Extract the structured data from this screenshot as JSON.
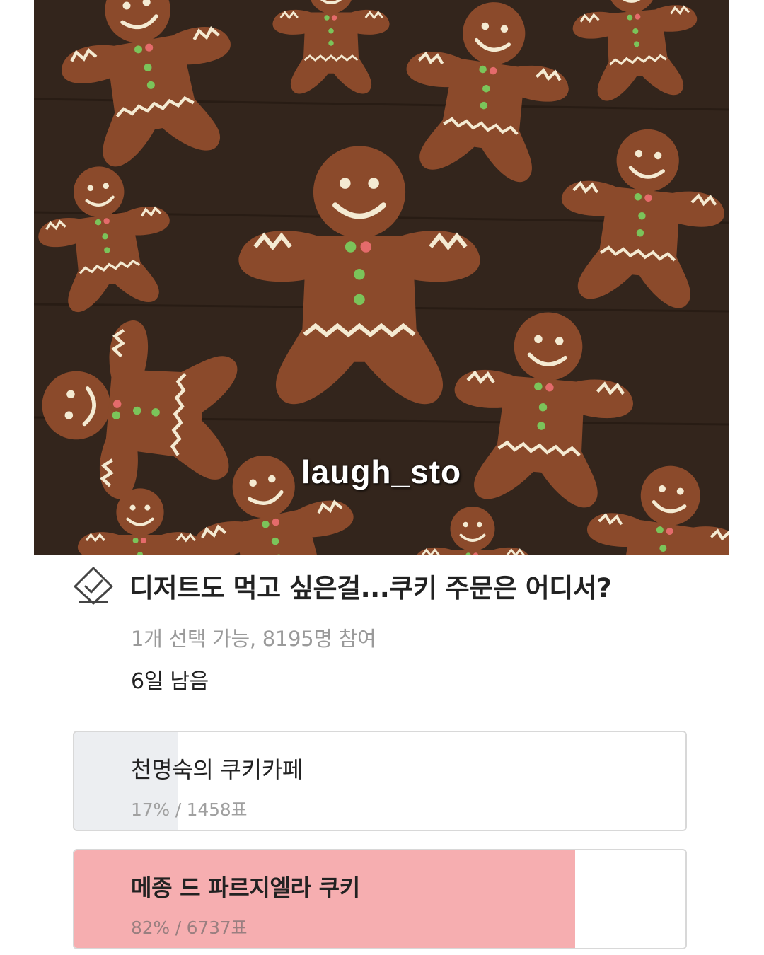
{
  "watermark": "laugh_sto",
  "poll": {
    "title": "디저트도 먹고 싶은걸...쿠키 주문은 어디서?",
    "meta": "1개 선택 가능, 8195명 참여",
    "remaining": "6일 남음",
    "options": [
      {
        "label": "천명숙의 쿠키카페",
        "percent": 17,
        "result": "17% / 1458표"
      },
      {
        "label": "메종 드 파르지엘라 쿠키",
        "percent": 82,
        "result": "82% / 6737표"
      }
    ]
  },
  "colors": {
    "winner_fill": "#f6aeb0",
    "loser_fill": "#eceef1",
    "border": "#d8d8d8",
    "cookie": "#8b4a2b",
    "wood": "#33251c"
  },
  "icons": {
    "poll": "check-ballot-icon"
  }
}
